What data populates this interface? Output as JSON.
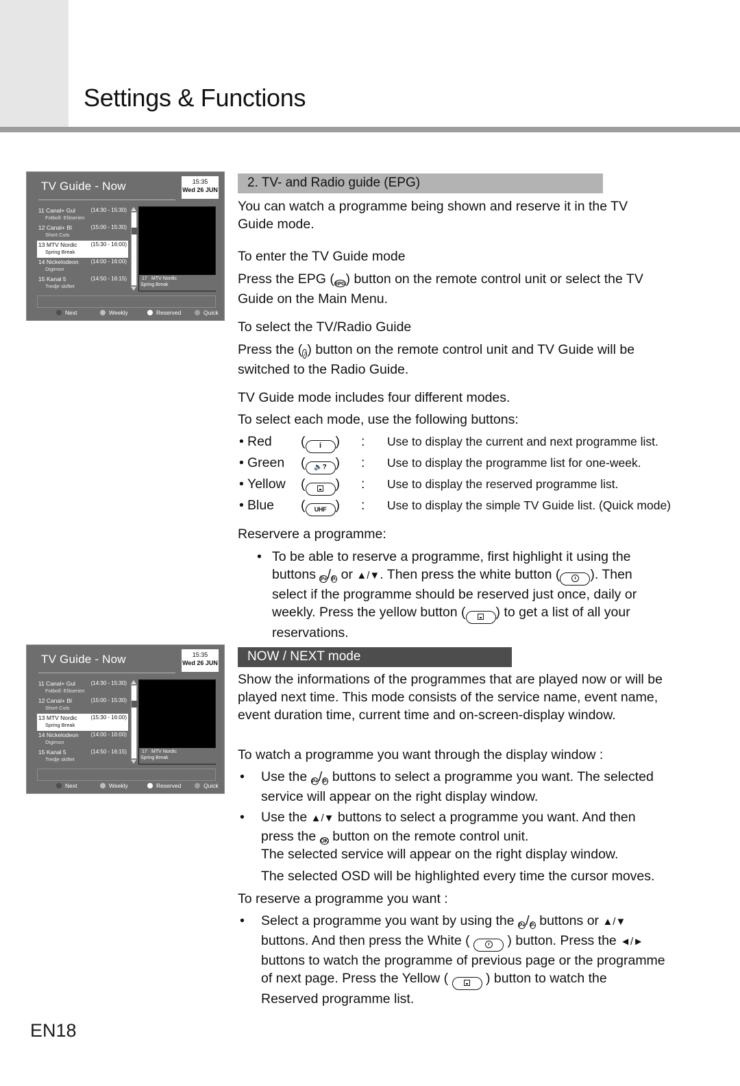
{
  "header": {
    "title": "Settings & Functions"
  },
  "footer": {
    "page_number": "EN18"
  },
  "tv_guide_screen": {
    "title": "TV Guide - Now",
    "clock_time": "15:35",
    "clock_date": "Wed 26 JUN",
    "programmes": [
      {
        "channel": "11 Canal+ Gul",
        "programme": "Fotboll: Elitserien",
        "time": "(14:30 - 15:30)",
        "selected": false
      },
      {
        "channel": "12 Canal+ Bl",
        "programme": "Short Cuts",
        "time": "(15:00 - 15:30)",
        "selected": false
      },
      {
        "channel": "13 MTV Nordic",
        "programme": "Spring Break",
        "time": "(15:30 - 16:00)",
        "selected": true
      },
      {
        "channel": "14 Nickelodeon",
        "programme": "Digimon",
        "time": "(14:00 - 16:00)",
        "selected": false
      },
      {
        "channel": "15 Kanal 5",
        "programme": "Tredje skiftet",
        "time": "(14:50 - 16:15)",
        "selected": false
      }
    ],
    "display_window": {
      "number": "17",
      "service": "MTV Nordic",
      "event": "Spring Break"
    },
    "keys": [
      {
        "label": "Next",
        "color": "#4f4f4f"
      },
      {
        "label": "Weekly",
        "color": "#bfbfbf"
      },
      {
        "label": "Reserved",
        "color": "#ffffff"
      },
      {
        "label": "Quick",
        "color": "#a0a0a0"
      }
    ]
  },
  "section_epg": {
    "heading": "2. TV- and Radio guide (EPG)",
    "intro": "You can watch a programme being shown and reserve it in the TV Guide mode.",
    "sub1_heading": "To enter the TV Guide mode",
    "sub1_text_a": "Press the EPG (",
    "sub1_icon": "EPG",
    "sub1_text_b": ") button on the remote control unit or select the TV Guide on the Main Menu.",
    "sub2_heading": "To select the TV/Radio Guide",
    "sub2_text_a": "Press the (",
    "sub2_icon": "music-note",
    "sub2_text_b": ") button on the remote control unit and TV Guide will be switched to the Radio Guide.",
    "modes_line1": "TV Guide mode includes four different modes.",
    "modes_line2": "To select each mode, use the following buttons:",
    "mode_buttons": [
      {
        "color": "Red",
        "icon": "info-i",
        "colon": ":",
        "description": "Use to display the current and next programme list."
      },
      {
        "color": "Green",
        "icon": "speaker-q",
        "colon": ":",
        "description": "Use to display the programme list for one-week."
      },
      {
        "color": "Yellow",
        "icon": "subtitle",
        "colon": ":",
        "description": "Use to display the reserved programme list."
      },
      {
        "color": "Blue",
        "icon": "UHF",
        "colon": ":",
        "description": "Use to display the simple TV Guide list. (Quick mode)"
      }
    ],
    "reserve_heading": "Reservere a programme:",
    "reserve_bullet": {
      "p1": "To be able to reserve a programme, first highlight it using the buttons ",
      "btn_pplus": "P+",
      "slash": "/",
      "btn_pminus": "P-",
      "p2": " or ",
      "arrows": "▲/▼",
      "p3": ". Then press the white button (",
      "btn_white": "clock",
      "p4": "). Then select if the programme should be reserved just once, daily or weekly. Press the yellow button (",
      "btn_yellow": "subtitle",
      "p5": ") to get a list of all your reservations."
    }
  },
  "section_nownext": {
    "heading": "NOW / NEXT mode",
    "intro": "Show the informations of the programmes that are played now or will be played next time. This mode consists of the service name, event name, event duration time, current time and on-screen-display window.",
    "watch_heading": "To watch a programme you want through the display window :",
    "watch_b1_a": "Use the ",
    "watch_b1_pplus": "P+",
    "watch_b1_pminus": "P-",
    "watch_b1_b": " buttons to select a programme you want. The selected service will appear on the right display window.",
    "watch_b2_a": "Use the ",
    "watch_b2_arrows": "▲/▼",
    "watch_b2_b": " buttons to select a programme you want. And then press the ",
    "watch_b2_ok": "OK",
    "watch_b2_c": " button on the remote control unit.",
    "watch_note1": "The selected service will appear on the right display window.",
    "watch_note2": "The selected OSD will be highlighted every time the cursor moves.",
    "reserve_heading": "To reserve a programme you want :",
    "reserve_b1_a": "Select a programme you want by using the ",
    "reserve_b1_pplus": "P+",
    "reserve_b1_pminus": "P-",
    "reserve_b1_b": " buttons or ",
    "reserve_b1_arrows1": "▲/▼",
    "reserve_b1_c": " buttons. And then press the White ( ",
    "reserve_b1_white": "clock",
    "reserve_b1_d": " ) button. Press the ",
    "reserve_b1_arrows2": "◄/►",
    "reserve_b1_e": " buttons to watch the programme of previous page or the programme of next page. Press the Yellow ( ",
    "reserve_b1_yellow": "subtitle",
    "reserve_b1_f": " ) button to watch the Reserved programme list."
  },
  "colors": {
    "header_rule": "#9d9d9d",
    "header_block": "#e6e6e6",
    "section_band_light": "#b3b3b3",
    "section_band_dark": "#4d4d4d",
    "screen_bg": "#6e6e6e"
  }
}
